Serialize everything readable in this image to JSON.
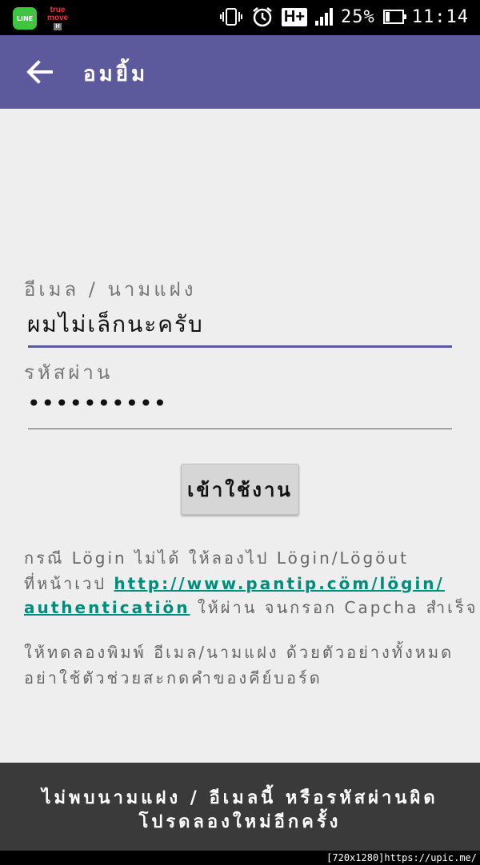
{
  "statusbar": {
    "line_label": "LINE",
    "truemove_top": "true",
    "truemove_bottom": "move",
    "truemove_badge": "H",
    "network": "H+",
    "battery_pct": "25%",
    "battery_level": 0.25,
    "time": "11:14"
  },
  "appbar": {
    "title": "อมยิ้ม"
  },
  "form": {
    "email_label": "อีเมล / นามแฝง",
    "email_value": "ผมไม่เล็กนะครับ",
    "password_label": "รหัสผ่าน",
    "password_value": "••••••••••",
    "login_button": "เข้าใช้งาน",
    "accent": "#5c5a9c"
  },
  "notes": {
    "line1": "กรณี Lögin ไม่ได้ ให้ลองไป Lögin/Lögöut",
    "line2_prefix": "ที่หน้าเวป ",
    "line2_link": "http://www.pantip.cöm/lögin/",
    "line3_link": "authenticatiön",
    "line3_suffix": " ให้ผ่าน จนกรอก Capcha สำเร็จ",
    "line4": "ให้ทดลองพิมพ์ อีเมล/นามแฝง ด้วยตัวอย่างทั้งหมด",
    "line5": "อย่าใช้ตัวช่วยสะกดคำของคีย์บอร์ด"
  },
  "toast": {
    "line1": "ไม่พบนามแฝง / อีเมลนี้ หรือรหัสผ่านผิด",
    "line2": "โปรดลองใหม่อีกครั้ง"
  },
  "credit": "[720x1280]https://upic.me/"
}
